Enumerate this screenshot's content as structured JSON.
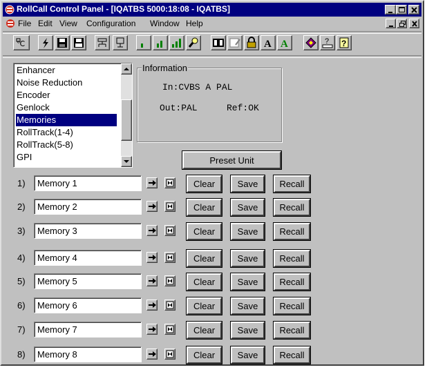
{
  "window": {
    "title": "RollCall Control Panel - [IQATBS 5000:18:08 - IQATBS]"
  },
  "menubar": {
    "items": [
      "File",
      "Edit",
      "View",
      "Configuration",
      "Window",
      "Help"
    ]
  },
  "toolbar": {
    "buttons": [
      "connect-icon",
      "lightning-icon",
      "save-disk-icon",
      "save-all-icon",
      "network-icon",
      "device-icon",
      "signal-low-icon",
      "signal-mid-icon",
      "signal-high-icon",
      "search-icon",
      "book-icon",
      "notes-icon",
      "lock-icon",
      "font-black-icon",
      "font-green-icon",
      "manual-icon",
      "keyboard-icon",
      "help-icon"
    ]
  },
  "listbox": {
    "items": [
      "Enhancer",
      "Noise Reduction",
      "Encoder",
      "Genlock",
      "Memories",
      "RollTrack(1-4)",
      "RollTrack(5-8)",
      "GPI"
    ],
    "selected": "Memories"
  },
  "information": {
    "label": "Information",
    "line1": "In:CVBS A PAL",
    "line2_out": "Out:PAL",
    "line2_ref": "Ref:OK"
  },
  "preset": {
    "label": "Preset Unit"
  },
  "buttons": {
    "clear": "Clear",
    "save": "Save",
    "recall": "Recall"
  },
  "memories": [
    {
      "num": "1)",
      "name": "Memory 1"
    },
    {
      "num": "2)",
      "name": "Memory 2"
    },
    {
      "num": "3)",
      "name": "Memory 3"
    },
    {
      "num": "4)",
      "name": "Memory 4"
    },
    {
      "num": "5)",
      "name": "Memory 5"
    },
    {
      "num": "6)",
      "name": "Memory 6"
    },
    {
      "num": "7)",
      "name": "Memory 7"
    },
    {
      "num": "8)",
      "name": "Memory 8"
    }
  ],
  "colors": {
    "titlebar": "#000080",
    "face": "#c0c0c0",
    "selection": "#000080"
  }
}
